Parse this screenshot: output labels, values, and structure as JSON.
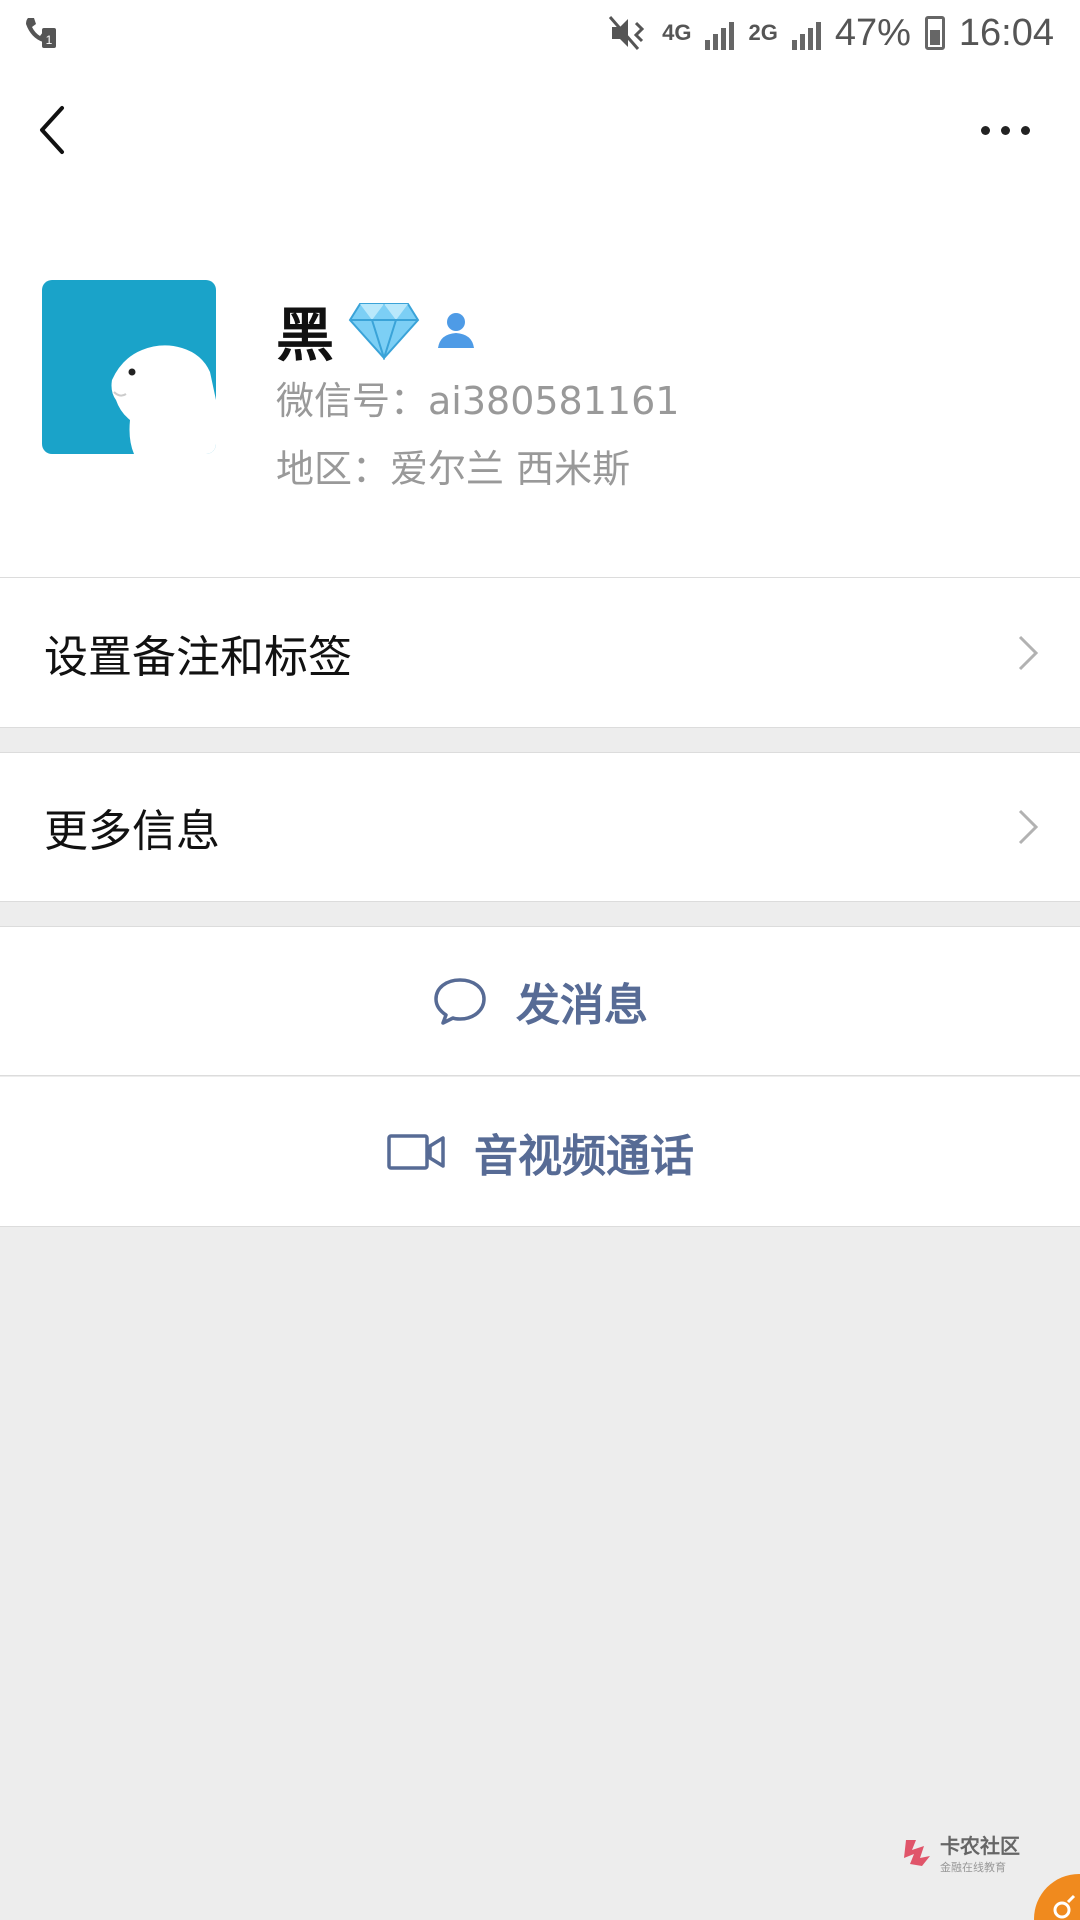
{
  "status_bar": {
    "network_4g": "4G",
    "network_2g": "2G",
    "battery": "47%",
    "time": "16:04",
    "icons": [
      "call-sim1-icon",
      "mute-vibrate-icon",
      "signal-icon",
      "battery-icon"
    ]
  },
  "nav": {
    "back_icon": "back-icon",
    "more_icon": "more-icon"
  },
  "profile": {
    "name": "黑",
    "wechat_id": "微信号：ai380581161",
    "region": "地区：爱尔兰  西米斯",
    "badges": [
      "diamond-icon",
      "contact-icon"
    ]
  },
  "menu": [
    {
      "label": "设置备注和标签"
    },
    {
      "label": "更多信息"
    }
  ],
  "actions": {
    "message": "发消息",
    "video_call": "音视频通话"
  },
  "watermark": {
    "title": "卡农社区",
    "subtitle": "金融在线教育"
  },
  "colors": {
    "link_blue": "#576b95",
    "avatar_bg": "#1aa3c9",
    "background": "#ededed"
  }
}
